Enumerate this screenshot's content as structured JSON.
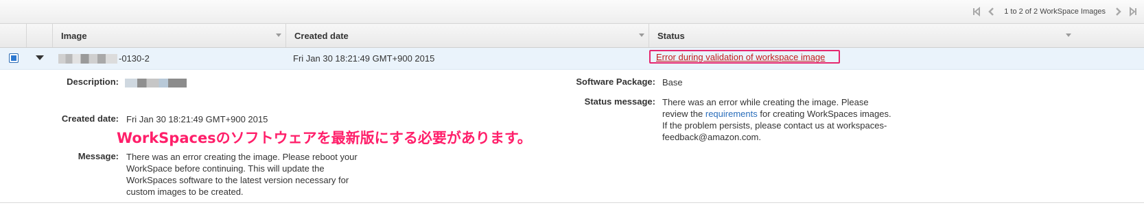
{
  "pager": {
    "text": "1 to 2 of 2 WorkSpace Images",
    "buttons": [
      "first-page-icon",
      "previous-page-icon",
      "next-page-icon",
      "last-page-icon"
    ]
  },
  "table": {
    "columns": [
      "Image",
      "Created date",
      "Status"
    ],
    "row": {
      "selected": true,
      "image_suffix": "-0130-2",
      "created_date": "Fri Jan 30 18:21:49 GMT+900 2015",
      "status": "Error during validation of workspace image"
    }
  },
  "details": {
    "description_label": "Description:",
    "created_date_label": "Created date:",
    "created_date_value": "Fri Jan 30 18:21:49 GMT+900 2015",
    "message_label": "Message:",
    "message_lines": [
      "There was an error creating the image. Please reboot your",
      "WorkSpace before continuing. This will update the",
      "WorkSpaces software to the latest version necessary for",
      "custom images to be created."
    ],
    "software_package_label": "Software Package:",
    "software_package_value": "Base",
    "status_message_label": "Status message:",
    "status_message": {
      "line1": "There was an error while creating the image. Please",
      "line2_before": "review the",
      "line2_link": "requirements",
      "line2_after": "for creating WorkSpaces images.",
      "line3": "If the problem persists, please contact us at workspaces-",
      "line4": "feedback@amazon.com."
    }
  },
  "annotation": "WorkSpacesのソフトウェアを最新版にする必要があります。",
  "colors": {
    "status_error": "#c21a1a",
    "highlight_border": "#e5266e",
    "annotation": "#ff1f6a",
    "link": "#2a6ebb",
    "selected_row": "#eaf3fb"
  }
}
